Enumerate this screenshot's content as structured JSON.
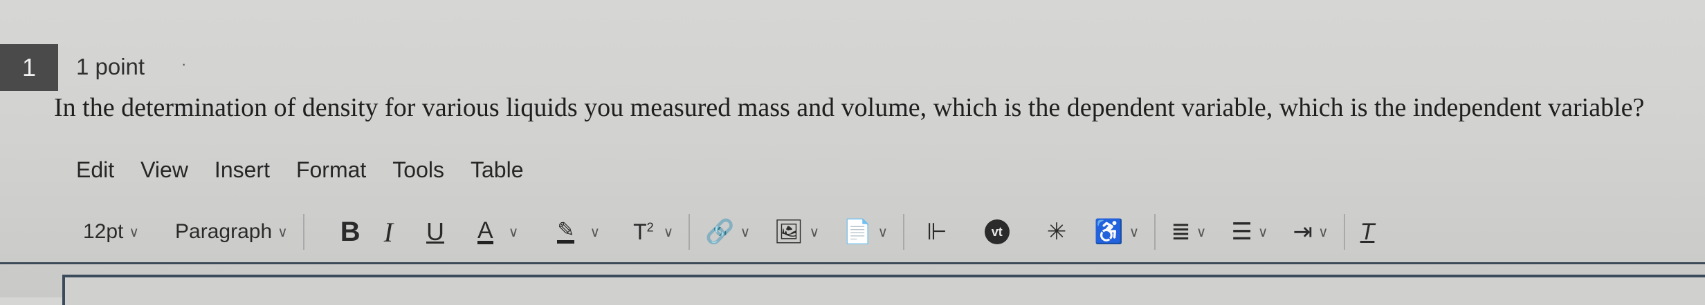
{
  "question": {
    "number": "1",
    "points": "1 point",
    "text": "In the determination of density for various liquids you measured mass and volume, which is the dependent variable, which is the independent variable?"
  },
  "menubar": {
    "items": [
      "Edit",
      "View",
      "Insert",
      "Format",
      "Tools",
      "Table"
    ]
  },
  "toolbar": {
    "font_size": "12pt",
    "block_format": "Paragraph",
    "bold_label": "B",
    "italic_label": "I",
    "underline_label": "U",
    "font_color_label": "A",
    "superscript_label": "T",
    "superscript_exp": "2",
    "chevron": "∨",
    "icons": {
      "highlight": "✎",
      "link": "🔗",
      "image": "🖼",
      "document": "📄",
      "apps": "⊩",
      "vt": "vt",
      "sparkle": "✳",
      "accessibility": "♿",
      "align": "≣",
      "list": "☰",
      "indent": "⇥",
      "clear": "T"
    }
  }
}
